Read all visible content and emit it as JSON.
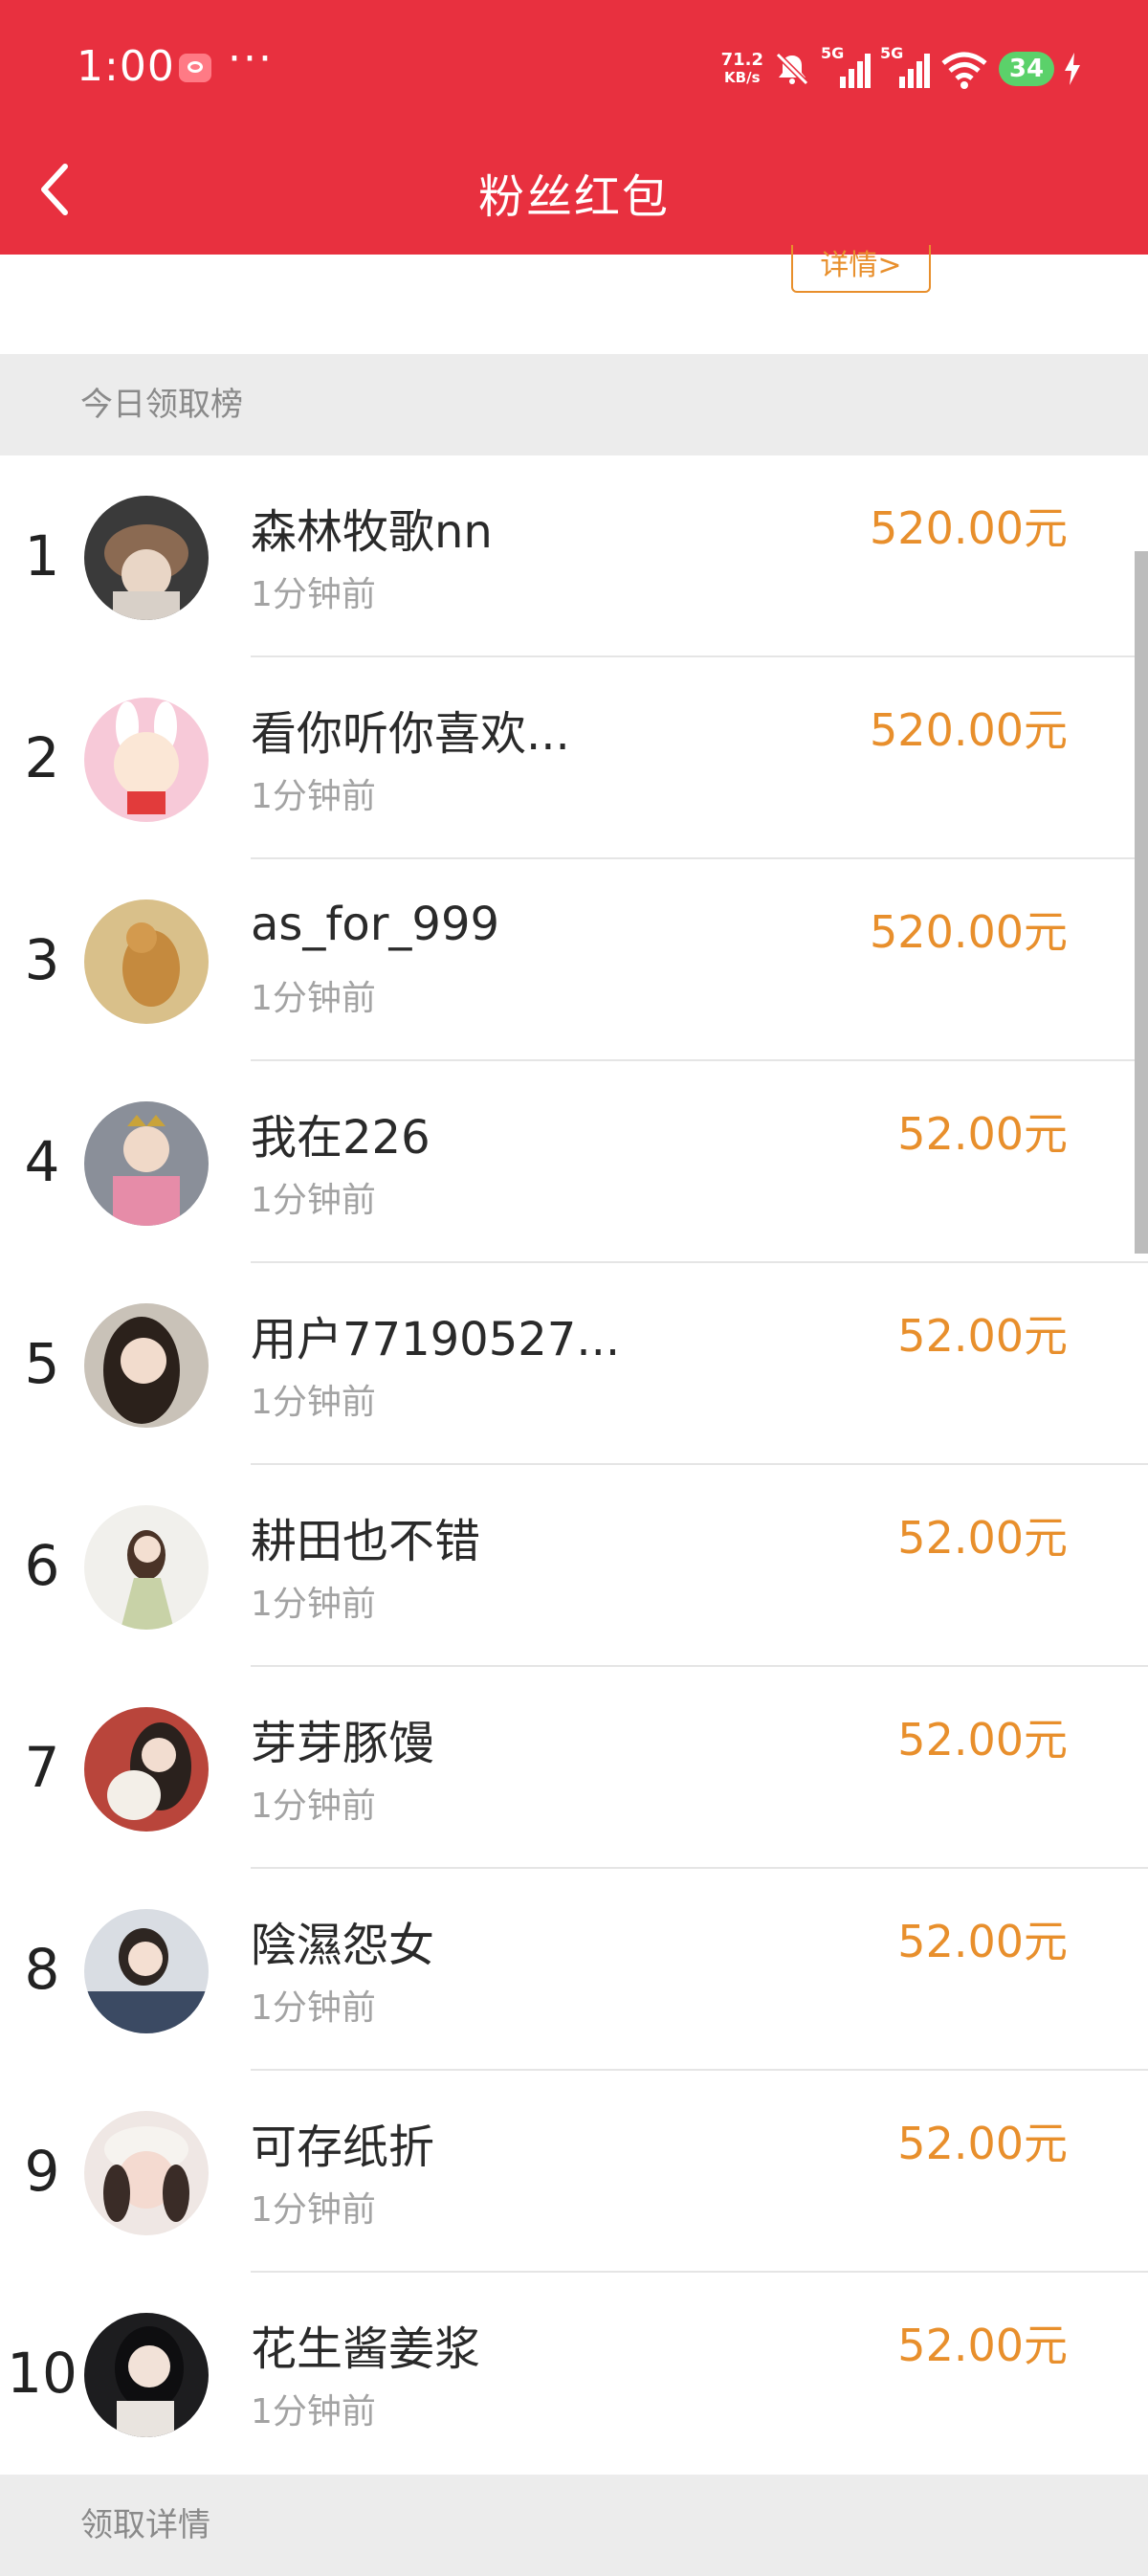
{
  "status_bar": {
    "time": "1:00",
    "dots": "···",
    "net_speed_value": "71.2",
    "net_speed_unit": "KB/s",
    "network_1": "5G",
    "network_2": "5G",
    "battery": "34",
    "battery_color": "#5bd16a"
  },
  "nav": {
    "title": "粉丝红包",
    "back_icon": "chevron-left-icon",
    "header_color": "#e8303f"
  },
  "top_card": {
    "detail_button": "详情>"
  },
  "leaderboard": {
    "title": "今日领取榜",
    "amount_color": "#e88f2c",
    "rows": [
      {
        "rank": "1",
        "name": "森林牧歌nn",
        "time": "1分钟前",
        "amount": "520.00元"
      },
      {
        "rank": "2",
        "name": "看你听你喜欢...",
        "time": "1分钟前",
        "amount": "520.00元"
      },
      {
        "rank": "3",
        "name": "as_for_999",
        "time": "1分钟前",
        "amount": "520.00元"
      },
      {
        "rank": "4",
        "name": "我在226",
        "time": "1分钟前",
        "amount": "52.00元"
      },
      {
        "rank": "5",
        "name": "用户77190527...",
        "time": "1分钟前",
        "amount": "52.00元"
      },
      {
        "rank": "6",
        "name": "耕田也不错",
        "time": "1分钟前",
        "amount": "52.00元"
      },
      {
        "rank": "7",
        "name": "芽芽豚馒",
        "time": "1分钟前",
        "amount": "52.00元"
      },
      {
        "rank": "8",
        "name": "陰濕怨女",
        "time": "1分钟前",
        "amount": "52.00元"
      },
      {
        "rank": "9",
        "name": "可存纸折",
        "time": "1分钟前",
        "amount": "52.00元"
      },
      {
        "rank": "10",
        "name": "花生酱姜浆",
        "time": "1分钟前",
        "amount": "52.00元"
      }
    ]
  },
  "details_section": {
    "title": "领取详情"
  }
}
